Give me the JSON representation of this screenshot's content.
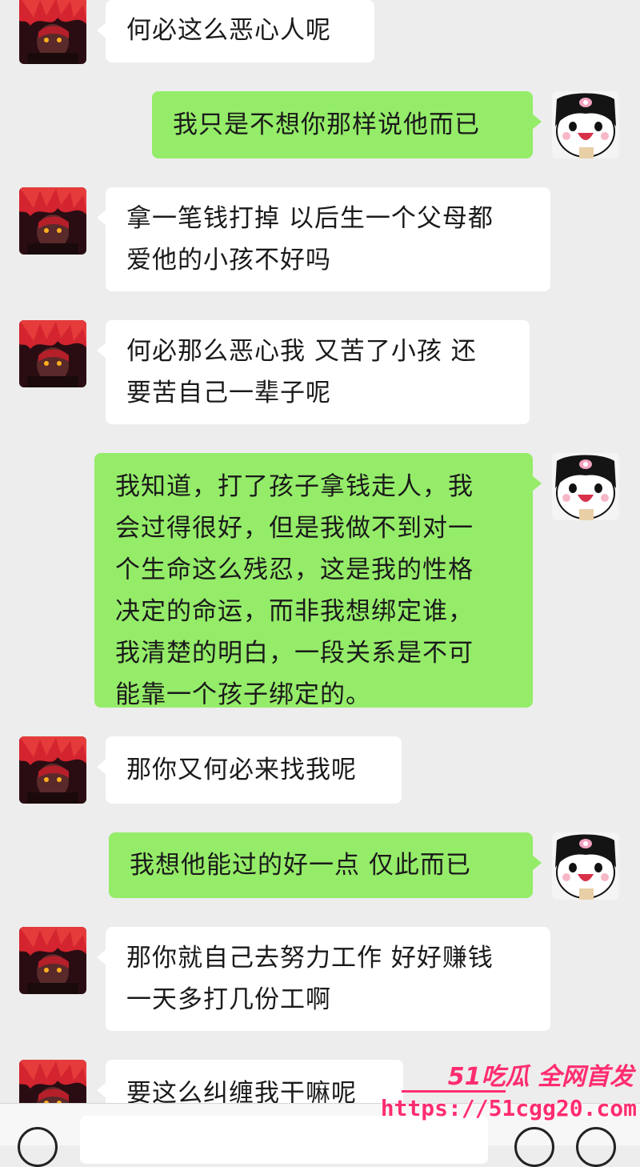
{
  "messages": [
    {
      "side": "left",
      "text": "何必这么恶心人呢"
    },
    {
      "side": "right",
      "text": "我只是不想你那样说他而已"
    },
    {
      "side": "left",
      "text": "拿一笔钱打掉 以后生一个父母都\n爱他的小孩不好吗"
    },
    {
      "side": "left",
      "text": "何必那么恶心我 又苦了小孩 还\n要苦自己一辈子呢"
    },
    {
      "side": "right",
      "text": "我知道，打了孩子拿钱走人，我\n会过得很好，但是我做不到对一\n个生命这么残忍，这是我的性格\n决定的命运，而非我想绑定谁，\n我清楚的明白，一段关系是不可\n能靠一个孩子绑定的。"
    },
    {
      "side": "left",
      "text": "那你又何必来找我呢"
    },
    {
      "side": "right",
      "text": "我想他能过的好一点 仅此而已"
    },
    {
      "side": "left",
      "text": "那你就自己去努力工作 好好赚钱\n一天多打几份工啊"
    },
    {
      "side": "left",
      "text": "要这么纠缠我干嘛呢"
    }
  ],
  "watermark": {
    "line1": "51吃瓜 全网首发",
    "line2": "https://51cgg20.com"
  },
  "colors": {
    "background": "#ededed",
    "bubble_self": "#95ec69",
    "bubble_other": "#ffffff",
    "watermark": "#ff2d6f"
  },
  "icons": {
    "voice": "voice-icon",
    "emoji": "emoji-icon",
    "plus": "plus-icon"
  }
}
